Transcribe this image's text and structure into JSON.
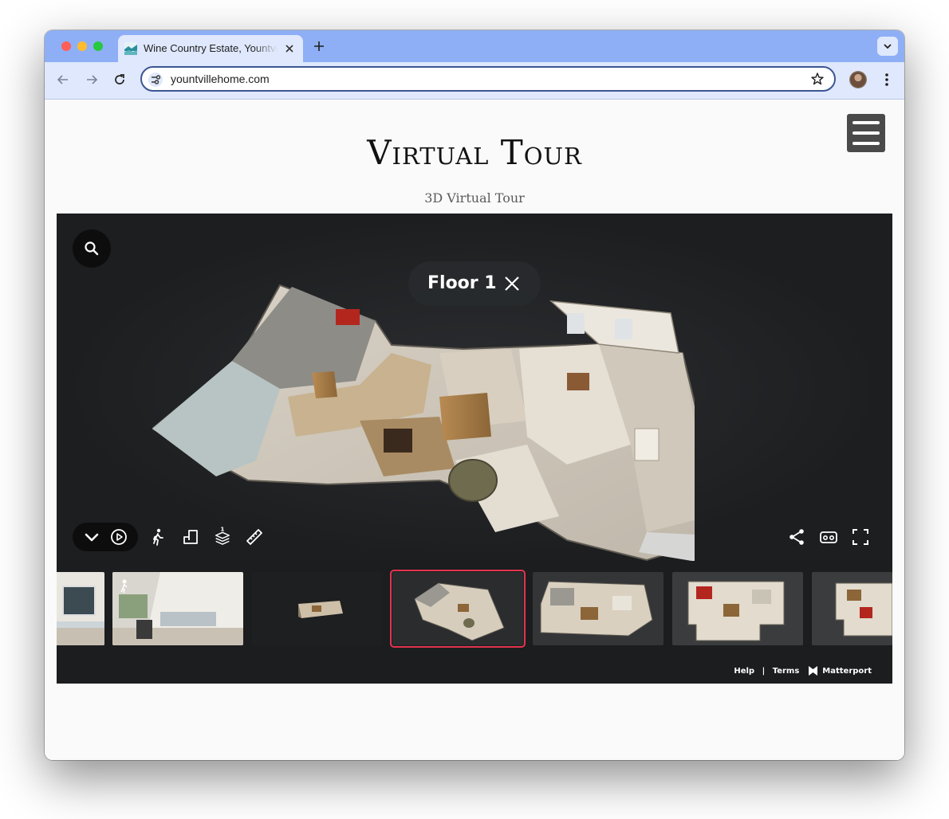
{
  "browser": {
    "tab_title": "Wine Country Estate, Yountville",
    "url": "yountvillehome.com"
  },
  "page": {
    "title": "Virtual Tour",
    "subtitle": "3D Virtual Tour"
  },
  "viewer": {
    "floor_label": "Floor 1",
    "floor_badge": "1",
    "footer": {
      "help": "Help",
      "separator": "|",
      "terms": "Terms",
      "brand": "Matterport"
    },
    "thumbnails": [
      {
        "kind": "room-photo",
        "active": false
      },
      {
        "kind": "room-photo-walkthrough",
        "active": false
      },
      {
        "kind": "dollhouse-side",
        "active": false
      },
      {
        "kind": "dollhouse-angled",
        "active": true
      },
      {
        "kind": "dollhouse-top",
        "active": false
      },
      {
        "kind": "floorplan",
        "active": false
      },
      {
        "kind": "floorplan-partial",
        "active": false
      }
    ]
  },
  "colors": {
    "tabbar": "#8eaff5",
    "toolbar": "#dfe8fc",
    "viewer_bg": "#1b1d1f",
    "active_thumb": "#e3344e"
  }
}
